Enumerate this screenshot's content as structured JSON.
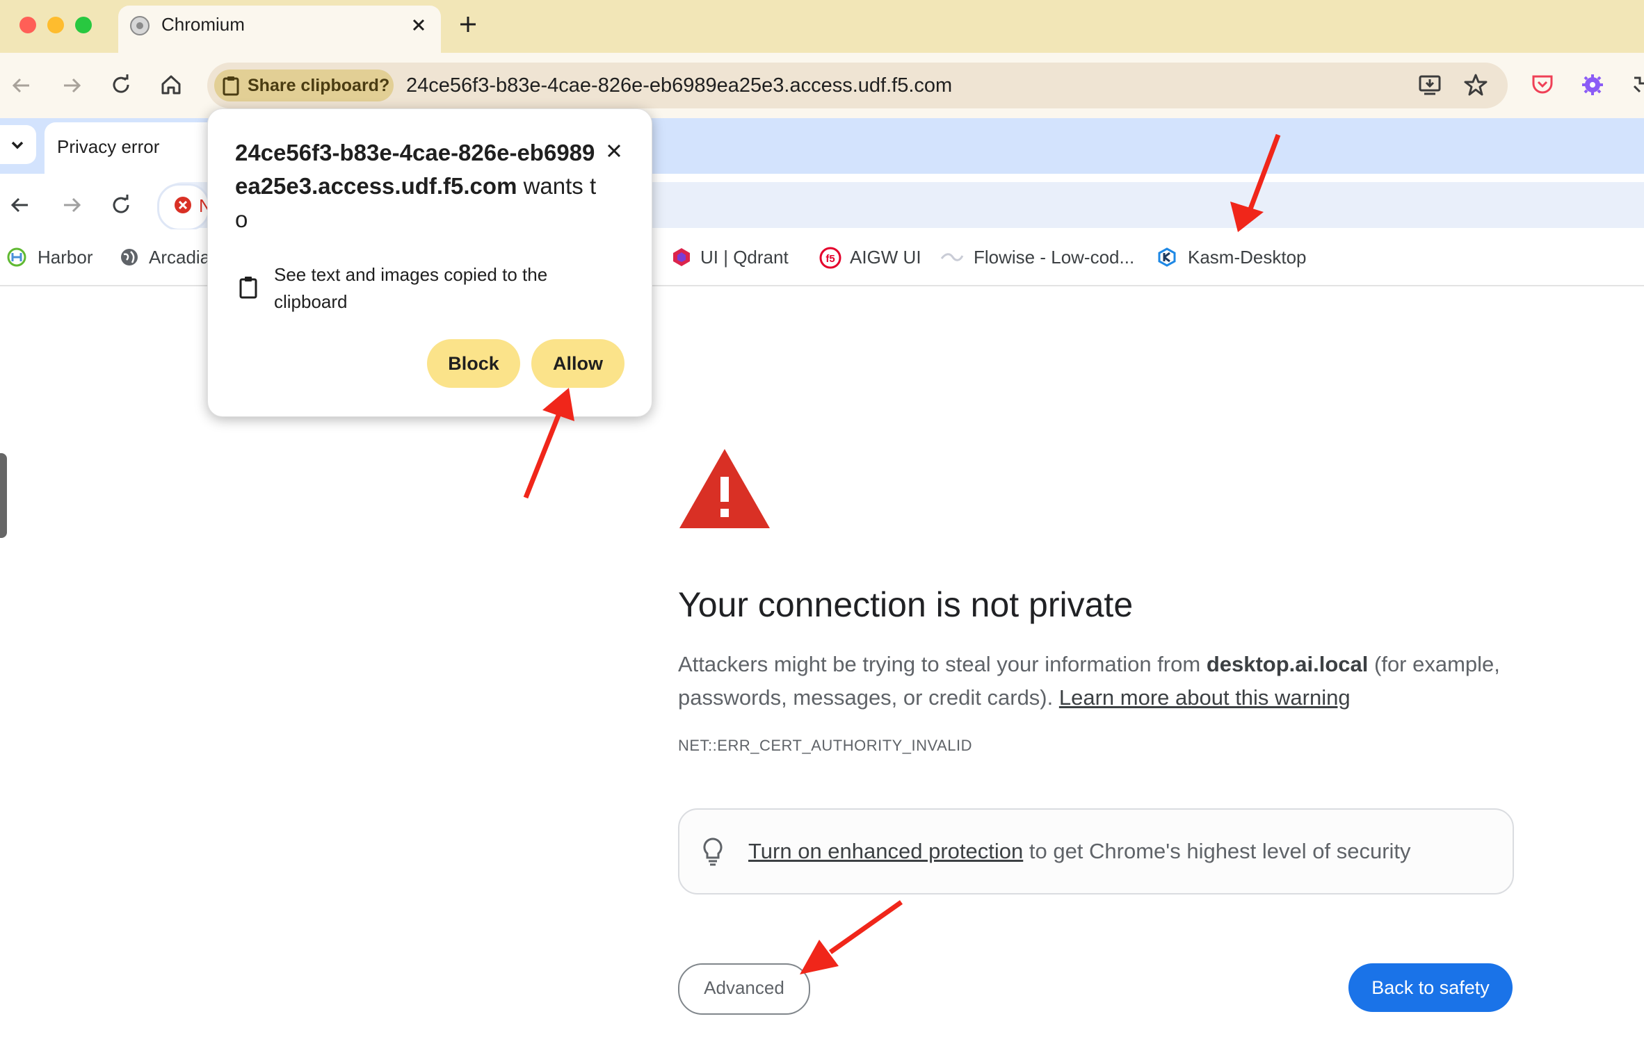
{
  "outer_browser": {
    "tab_title": "Chromium",
    "share_chip_label": "Share clipboard?",
    "url": "24ce56f3-b83e-4cae-826e-eb6989ea25e3.access.udf.f5.com"
  },
  "inner_browser": {
    "tab_title": "Privacy error",
    "omnibox_partial": "N",
    "bookmarks": [
      {
        "label": "Harbor",
        "icon": "harbor-icon"
      },
      {
        "label": "Arcadia",
        "icon": "globe-icon"
      },
      {
        "label": "UI | Qdrant",
        "icon": "qdrant-icon"
      },
      {
        "label": "AIGW UI",
        "icon": "f5-icon"
      },
      {
        "label": "Flowise - Low-cod...",
        "icon": "flowise-icon"
      },
      {
        "label": "Kasm-Desktop",
        "icon": "kasm-icon"
      }
    ]
  },
  "popup": {
    "origin": "24ce56f3-b83e-4cae-826e-eb6989ea25e3.access.udf.f5.com",
    "suffix": " wants to",
    "permission": "See text and images copied to the clipboard",
    "block_label": "Block",
    "allow_label": "Allow"
  },
  "page": {
    "heading": "Your connection is not private",
    "body_prefix": "Attackers might be trying to steal your information from ",
    "host": "desktop.ai.local",
    "body_suffix": " (for example, passwords, messages, or credit cards). ",
    "learn_more": "Learn more about this warning",
    "error_code": "NET::ERR_CERT_AUTHORITY_INVALID",
    "enhanced_link": "Turn on enhanced protection",
    "enhanced_rest": " to get Chrome's highest level of security",
    "advanced_label": "Advanced",
    "back_label": "Back to safety"
  },
  "colors": {
    "warning_red": "#d93025",
    "primary_blue": "#1a73e8",
    "annotation_arrow": "#f0261a",
    "popup_button": "#fbe38a"
  }
}
